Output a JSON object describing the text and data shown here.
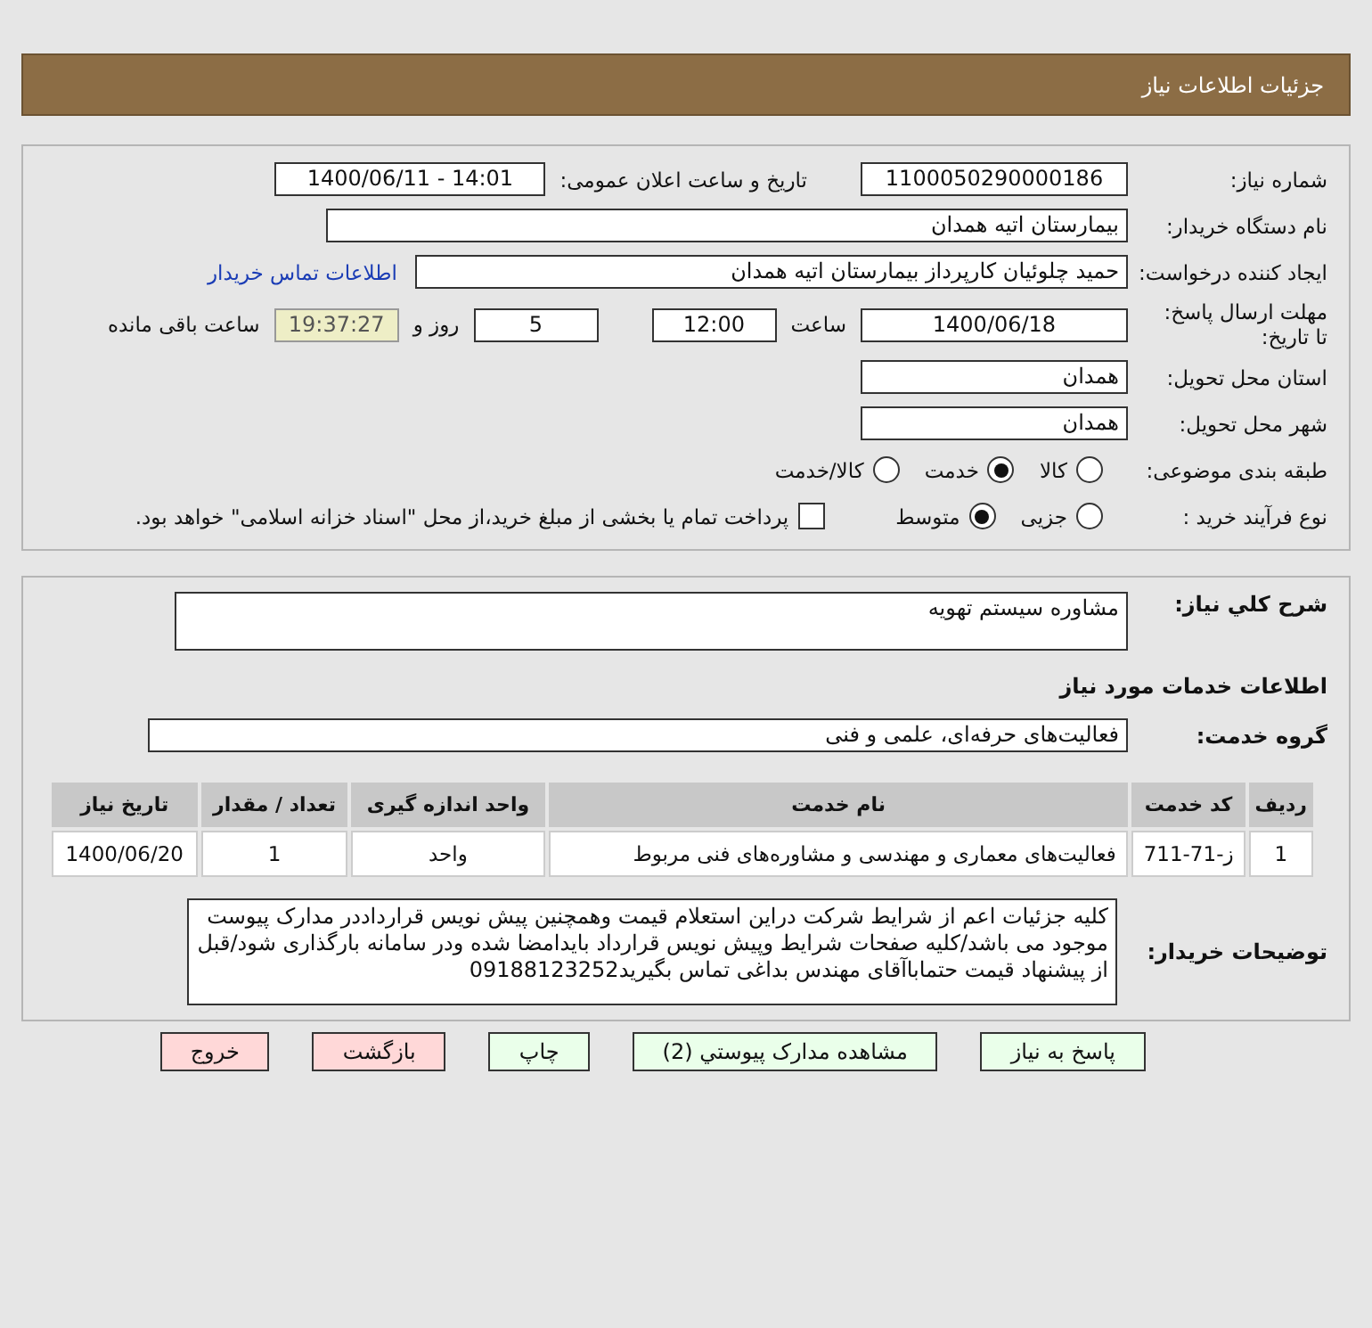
{
  "header": {
    "title": "جزئیات اطلاعات نیاز"
  },
  "need_number": {
    "label": "شماره نیاز:",
    "value": "1100050290000186"
  },
  "announce": {
    "label": "تاریخ و ساعت اعلان عمومی:",
    "value": "1400/06/11 - 14:01"
  },
  "buyer_org": {
    "label": "نام دستگاه خریدار:",
    "value": "بیمارستان اتیه همدان"
  },
  "requester": {
    "label": "ایجاد کننده درخواست:",
    "value": "حمید چلوئیان  کارپرداز بیمارستان اتیه همدان",
    "link": "اطلاعات تماس خریدار"
  },
  "deadline": {
    "label": "مهلت ارسال پاسخ: تا تاریخ:",
    "date": "1400/06/18",
    "time_label": "ساعت",
    "time": "12:00",
    "days": "5",
    "days_label": "روز و",
    "remaining": "19:37:27",
    "remaining_label": "ساعت باقی مانده"
  },
  "province": {
    "label": "استان محل تحویل:",
    "value": "همدان"
  },
  "city": {
    "label": "شهر محل تحویل:",
    "value": "همدان"
  },
  "category": {
    "label": "طبقه بندی موضوعی:",
    "options": [
      {
        "label": "کالا",
        "selected": false
      },
      {
        "label": "خدمت",
        "selected": true
      },
      {
        "label": "کالا/خدمت",
        "selected": false
      }
    ]
  },
  "process": {
    "label": "نوع فرآیند خرید :",
    "options": [
      {
        "label": "جزیی",
        "selected": false
      },
      {
        "label": "متوسط",
        "selected": true
      }
    ],
    "payment": {
      "label": "پرداخت تمام یا بخشی از مبلغ خرید،از محل \"اسناد خزانه اسلامی\" خواهد بود.",
      "checked": false
    }
  },
  "summary": {
    "label": "شرح کلي نياز:",
    "value": "مشاوره سیستم تهویه"
  },
  "services_title": "اطلاعات خدمات مورد نیاز",
  "service_group": {
    "label": "گروه خدمت:",
    "value": "فعالیت‌های حرفه‌ای، علمی و فنی"
  },
  "table": {
    "columns": [
      "ردیف",
      "کد خدمت",
      "نام خدمت",
      "واحد اندازه گیری",
      "تعداد / مقدار",
      "تاریخ نیاز"
    ],
    "rows": [
      [
        "1",
        "ز-71-711",
        "فعالیت‌های معماری و مهندسی و مشاوره‌های فنی مربوط",
        "واحد",
        "1",
        "1400/06/20"
      ]
    ]
  },
  "buyer_notes": {
    "label": "توضیحات خریدار:",
    "value": "کلیه جزئیات اعم از شرایط شرکت دراین استعلام قیمت وهمچنین پیش نویس قرارداددر مدارک پیوست موجود می باشد/کلیه صفحات شرایط وپیش نویس قرارداد بایدامضا شده ودر سامانه بارگذاری شود/قبل از پیشنهاد قیمت حتماباآقای مهندس بداغی تماس بگیرید09188123252"
  },
  "buttons": [
    {
      "label": "پاسخ به نیاز",
      "kind": "normal"
    },
    {
      "label": "مشاهده مدارک پیوستي (2)",
      "kind": "normal"
    },
    {
      "label": "چاپ",
      "kind": "normal"
    },
    {
      "label": "بازگشت",
      "kind": "danger"
    },
    {
      "label": "خروج",
      "kind": "danger"
    }
  ]
}
